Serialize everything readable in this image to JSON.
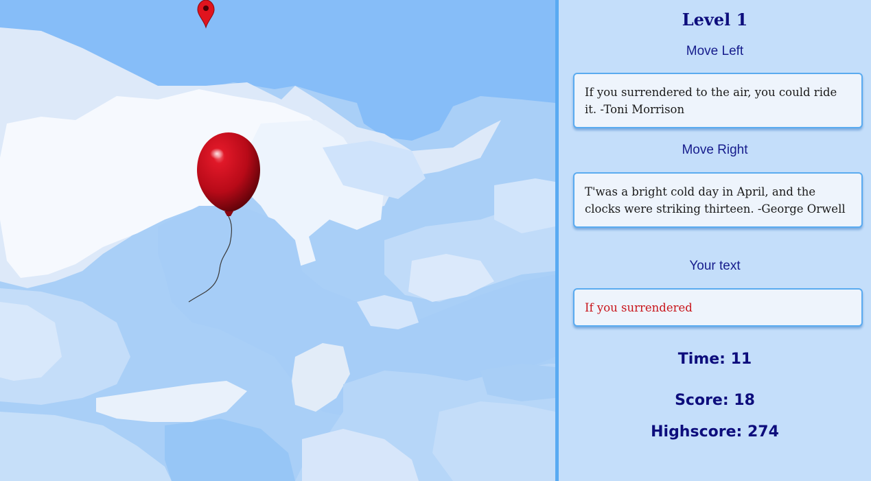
{
  "level": {
    "title": "Level 1"
  },
  "move_left": {
    "label": "Move Left",
    "text": "If you surrendered to the air, you could ride it. -Toni Morrison"
  },
  "move_right": {
    "label": "Move Right",
    "text": "T'was a bright cold day in April, and the clocks were striking thirteen. -George Orwell"
  },
  "your_text": {
    "label": "Your text",
    "typed": "If you surrendered"
  },
  "stats": {
    "time": "Time: 11",
    "score": "Score: 18",
    "highscore": "Highscore: 274"
  },
  "game": {
    "player_icon": "red-balloon",
    "target_icon": "map-pin-icon"
  },
  "colors": {
    "accent": "#59aaf2",
    "title": "#0d0d7c",
    "typed_text": "#c8141a",
    "balloon": "#c8101d",
    "sky": "#a9cff7"
  }
}
